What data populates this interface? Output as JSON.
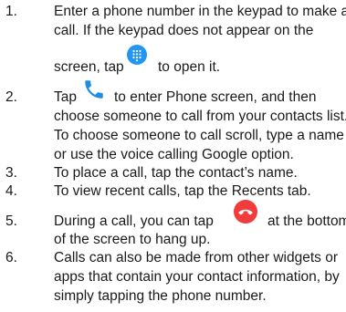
{
  "steps": [
    {
      "number": "1.",
      "line1": "Enter a phone number in the keypad to make a",
      "line2": "call. If the keypad does not appear on the",
      "line3_before": "screen, tap",
      "line3_after": "to open it."
    },
    {
      "number": "2.",
      "line1_before": "Tap",
      "line1_after": "to enter Phone screen, and then",
      "line2": "choose someone to call from your contacts list.",
      "line3": "To choose someone to call scroll, type a name",
      "line4": "or use the voice calling Google option."
    },
    {
      "number": "3.",
      "line1": "To place a call, tap the contact’s name."
    },
    {
      "number": "4.",
      "line1": "To view recent calls, tap the Recents tab."
    },
    {
      "number": "5.",
      "line1_before": "During a call, you can tap",
      "line1_after": "at the bottom",
      "line2": "of the screen to hang up."
    },
    {
      "number": "6.",
      "line1": "Calls can also be made from other widgets or",
      "line2": "apps that contain your contact information, by",
      "line3": "simply tapping the phone number."
    }
  ],
  "icons": {
    "keypad": {
      "name": "dialpad-icon",
      "color": "#2196f3"
    },
    "phone": {
      "name": "phone-icon",
      "color": "#1e8fe0"
    },
    "hangup": {
      "name": "end-call-icon",
      "color": "#f03c3c"
    }
  }
}
